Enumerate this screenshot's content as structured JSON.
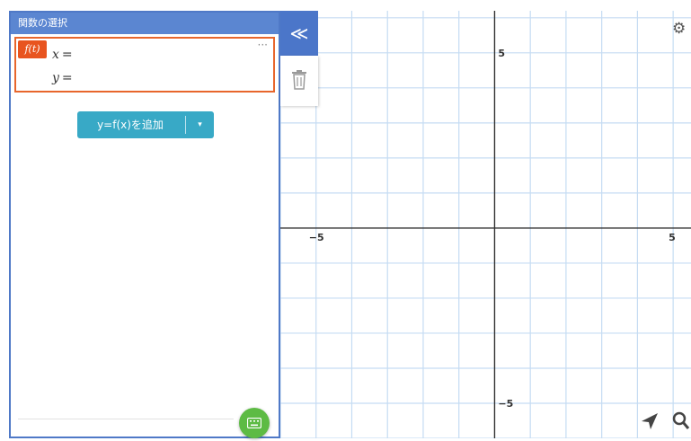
{
  "panel": {
    "title": "関数の選択",
    "function": {
      "badge": "f(t)",
      "more": "···",
      "x_label": "x",
      "y_label": "y",
      "equals": "="
    },
    "add_button": {
      "label": "y=f(x)を追加",
      "caret": "▾"
    }
  },
  "tools": {
    "collapse_label": "≪"
  },
  "graph": {
    "x_range": [
      -6,
      5.5
    ],
    "y_range": [
      -6,
      6.2
    ],
    "grid_step": 1,
    "tick_labels": {
      "x_neg": "−5",
      "x_pos": "5",
      "y_pos": "5",
      "y_neg": "−5"
    }
  },
  "colors": {
    "panel_header": "#5b86d1",
    "accent_orange": "#e8541f",
    "add_button": "#38a9c6",
    "grid": "#c5dcf3",
    "axis": "#333333",
    "keyboard_button": "#5dbb44"
  },
  "icons": [
    "collapse-icon",
    "trash-icon",
    "gear-icon",
    "keyboard-icon",
    "navigate-arrow-icon",
    "zoom-icon"
  ]
}
